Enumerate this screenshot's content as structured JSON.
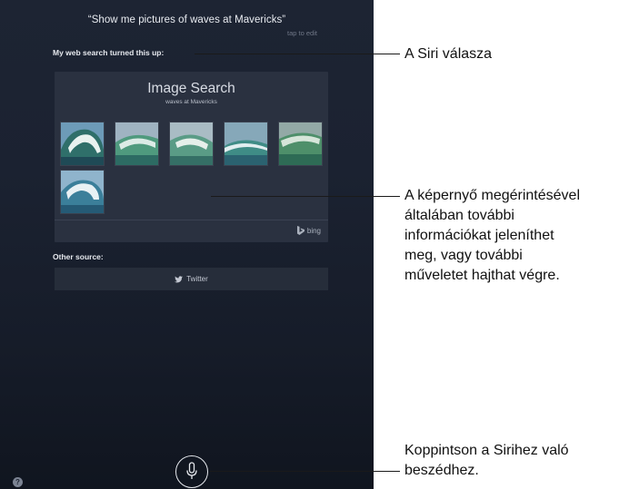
{
  "siri": {
    "query": "“Show me pictures of waves at Mavericks”",
    "tap_to_edit": "tap to edit",
    "web_heading": "My web search turned this up:",
    "image_search": {
      "title": "Image Search",
      "subtitle": "waves at Mavericks",
      "thumbnail_count": 6,
      "provider": "bing"
    },
    "other_source_heading": "Other source:",
    "twitter_label": "Twitter",
    "help_label": "?"
  },
  "callouts": [
    {
      "lines": [
        "A Siri válasza"
      ]
    },
    {
      "lines": [
        "A képernyő megérintésével",
        "általában további",
        "információkat jeleníthet",
        "meg, vagy további",
        "műveletet hajthat végre."
      ]
    },
    {
      "lines": [
        "Koppintson a Sirihez való",
        "beszédhez."
      ]
    }
  ],
  "colors": {
    "background": "#1b2231",
    "card": "#2a3140",
    "text": "#e6e9ee",
    "callout_text": "#111111"
  }
}
